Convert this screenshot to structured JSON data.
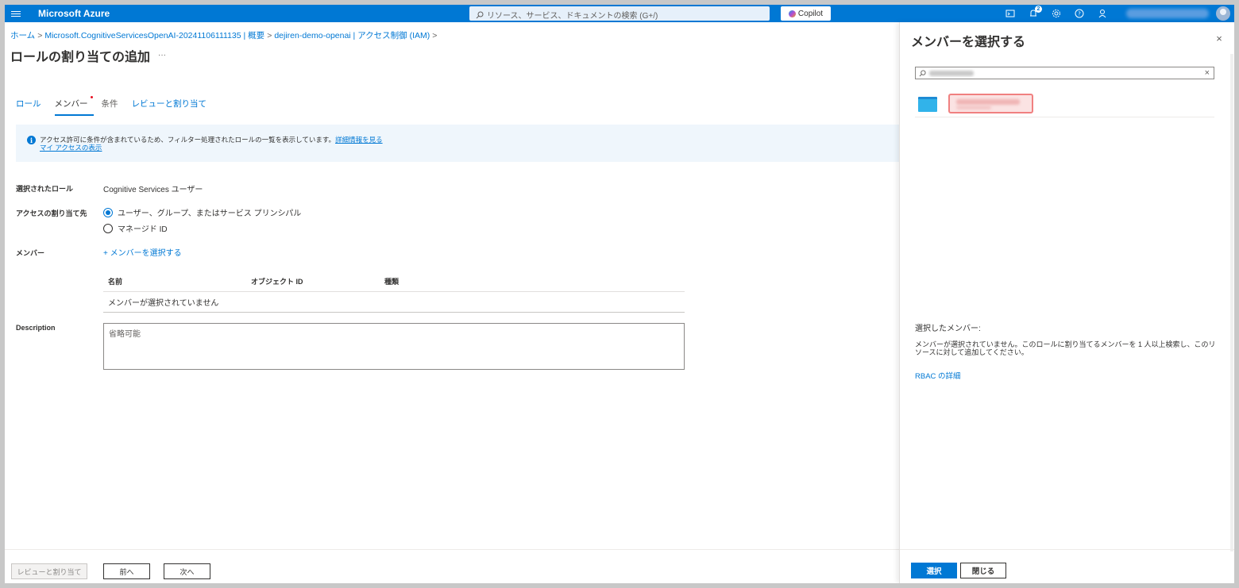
{
  "topbar": {
    "brand": "Microsoft Azure",
    "search_placeholder": "リソース、サービス、ドキュメントの検索 (G+/)",
    "copilot_label": "Copilot",
    "notification_count": "2",
    "icons": [
      "cloud-shell-icon",
      "notifications-icon",
      "settings-icon",
      "help-icon",
      "feedback-icon"
    ]
  },
  "breadcrumb": {
    "items": [
      "ホーム",
      "Microsoft.CognitiveServicesOpenAI-20241106111135 | 概要",
      "dejiren-demo-openai | アクセス制御 (IAM)"
    ]
  },
  "page": {
    "title": "ロールの割り当ての追加",
    "more": "···"
  },
  "tabs": [
    "ロール",
    "メンバー",
    "条件",
    "レビューと割り当て"
  ],
  "info": {
    "text": "アクセス許可に条件が含まれているため、フィルター処理されたロールの一覧を表示しています。",
    "link1": "詳細情報を見る",
    "link2": "マイ アクセスの表示"
  },
  "form": {
    "role_label": "選択されたロール",
    "role_value": "Cognitive Services ユーザー",
    "assign_label": "アクセスの割り当て先",
    "assign_option1": "ユーザー、グループ、またはサービス プリンシパル",
    "assign_option2": "マネージド ID",
    "members_label": "メンバー",
    "select_members_link": "+ メンバーを選択する",
    "table_headers": [
      "名前",
      "オブジェクト ID",
      "種類"
    ],
    "table_empty": "メンバーが選択されていません",
    "description_label": "Description",
    "description_placeholder": "省略可能"
  },
  "footer": {
    "review_button": "レビューと割り当て",
    "prev_button": "前へ",
    "next_button": "次へ"
  },
  "panel": {
    "title": "メンバーを選択する",
    "close": "×",
    "search_clear": "×",
    "selected_members_label": "選択したメンバー:",
    "selected_members_desc": "メンバーが選択されていません。このロールに割り当てるメンバーを 1 人以上検索し、このリソースに対して追加してください。",
    "rbac_link": "RBAC の詳細",
    "select_button": "選択",
    "close_button": "閉じる"
  },
  "colors": {
    "accent": "#0078d4",
    "info_bg": "#eff6fc",
    "highlight": "#f08080"
  }
}
